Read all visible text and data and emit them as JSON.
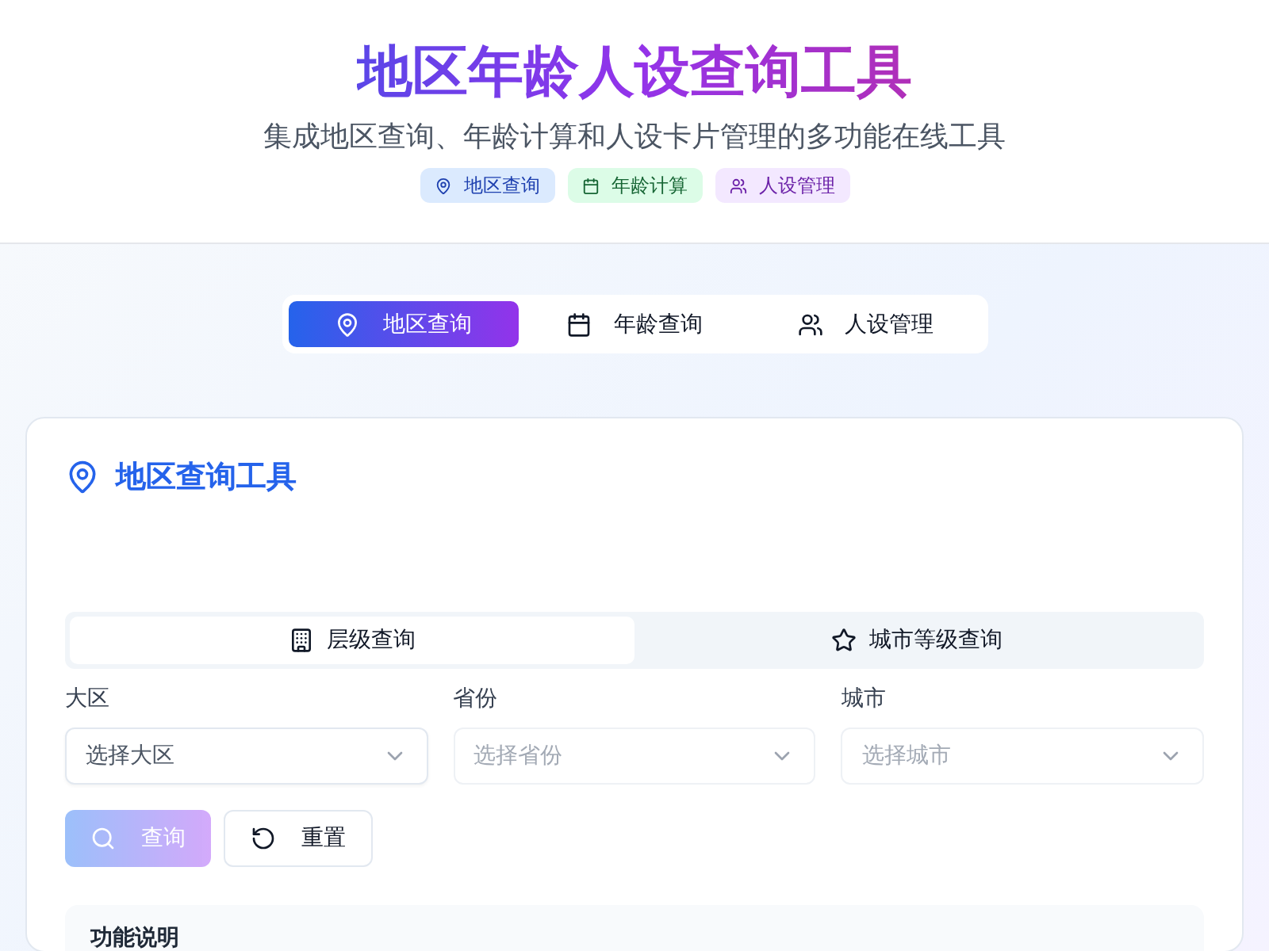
{
  "header": {
    "title": "地区年龄人设查询工具",
    "subtitle": "集成地区查询、年龄计算和人设卡片管理的多功能在线工具",
    "badges": [
      {
        "label": "地区查询",
        "kind": "pin",
        "color": "#dbeafe"
      },
      {
        "label": "年龄计算",
        "kind": "calendar",
        "color": "#dcfce7"
      },
      {
        "label": "人设管理",
        "kind": "users",
        "color": "#f3e8ff"
      }
    ]
  },
  "tabs": [
    {
      "label": "地区查询",
      "kind": "pin",
      "selected": true
    },
    {
      "label": "年龄查询",
      "kind": "calendar",
      "selected": false
    },
    {
      "label": "人设管理",
      "kind": "users",
      "selected": false
    }
  ],
  "card": {
    "title": "地区查询工具",
    "subtabs": [
      {
        "label": "层级查询",
        "kind": "building",
        "selected": true
      },
      {
        "label": "城市等级查询",
        "kind": "star",
        "selected": false
      }
    ],
    "fields": [
      {
        "label": "大区",
        "placeholder": "选择大区",
        "disabled": false
      },
      {
        "label": "省份",
        "placeholder": "选择省份",
        "disabled": true
      },
      {
        "label": "城市",
        "placeholder": "选择城市",
        "disabled": true
      }
    ],
    "buttons": [
      {
        "label": "查询",
        "kind": "search",
        "disabled": true
      },
      {
        "label": "重置",
        "kind": "reset",
        "disabled": false
      }
    ],
    "info": {
      "title": "功能说明"
    }
  }
}
